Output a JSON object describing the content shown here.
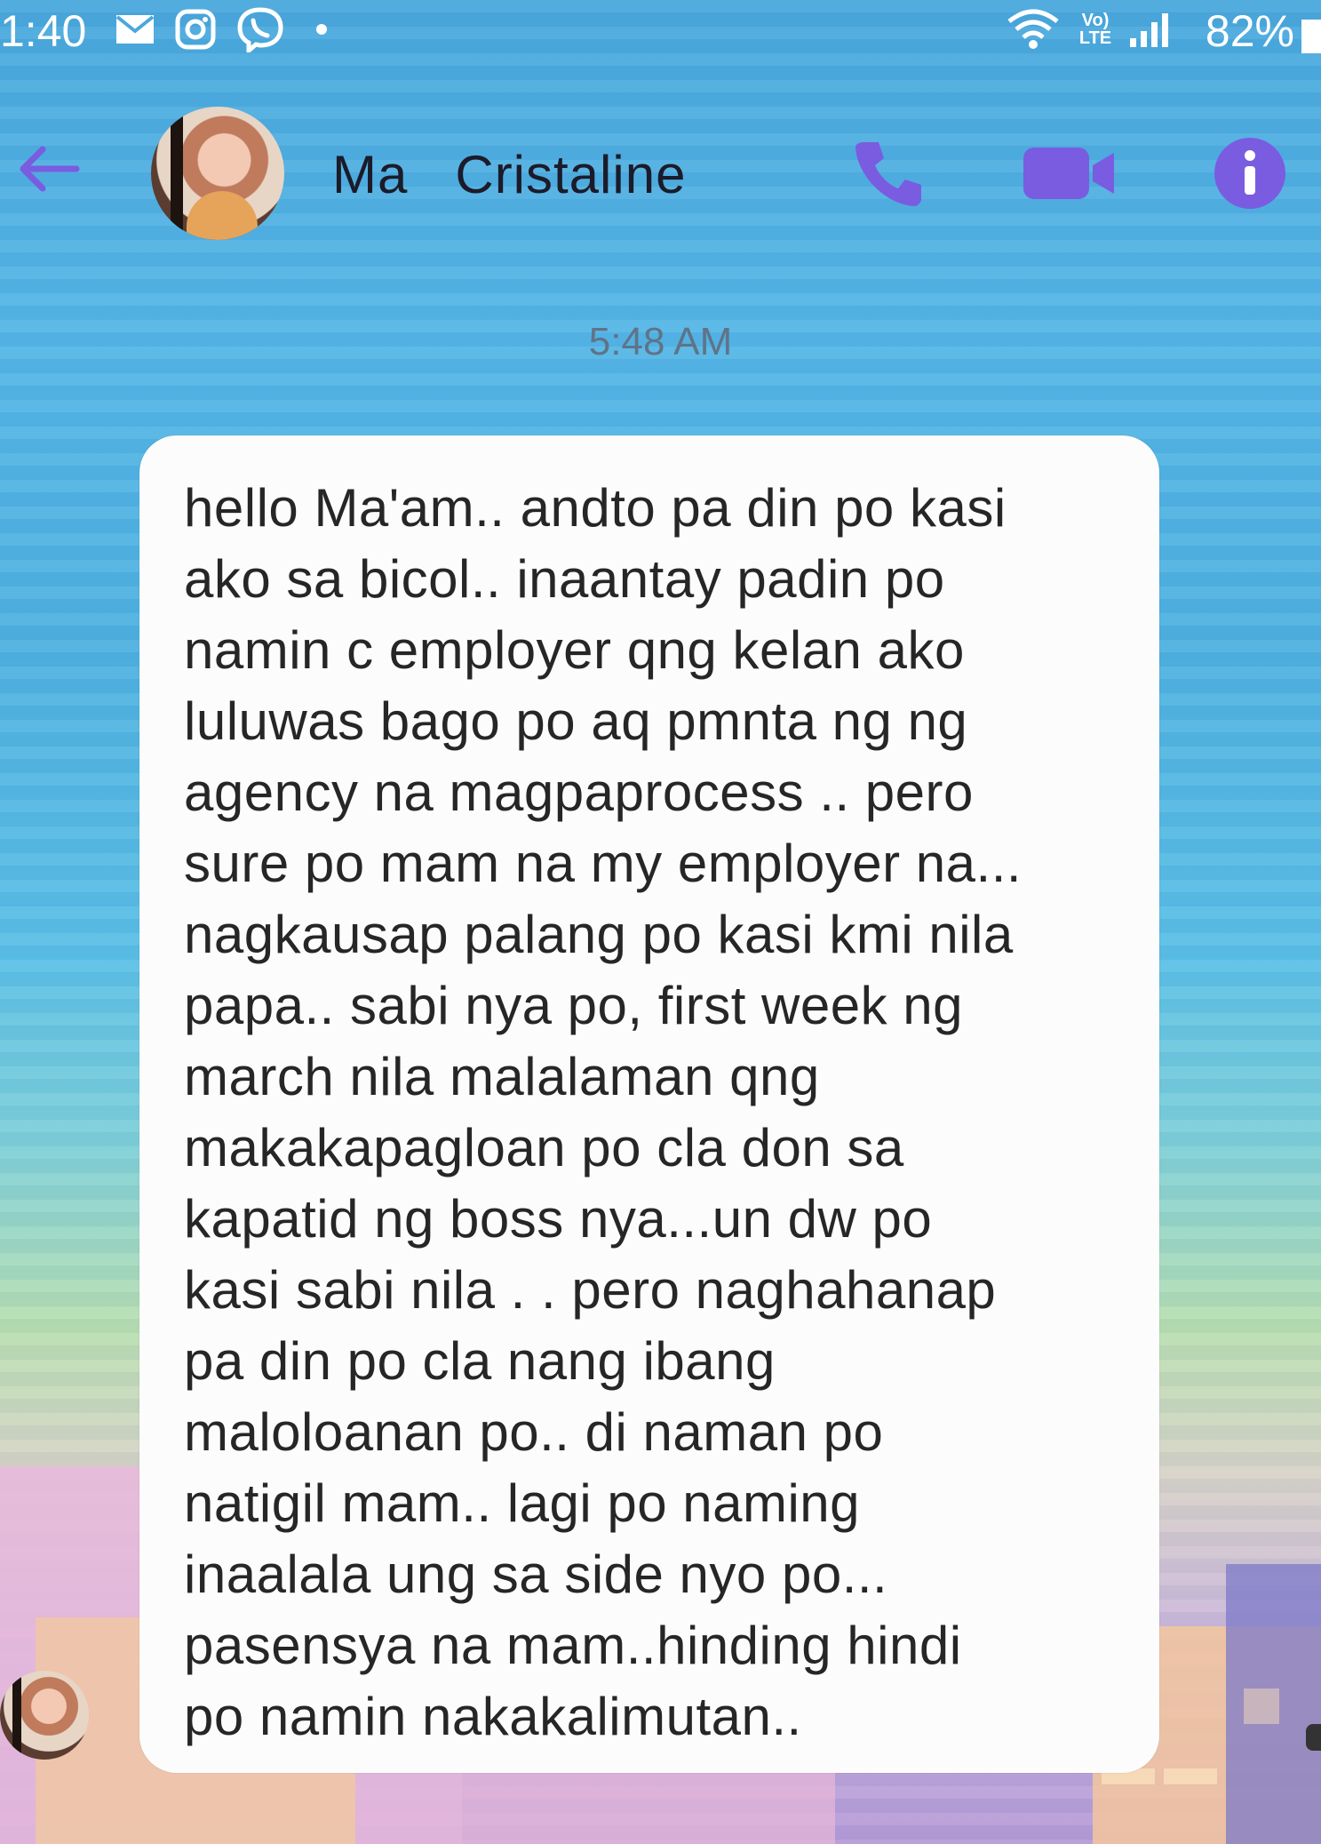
{
  "status_bar": {
    "time": "1:40",
    "battery": "82%",
    "icons": [
      "mail-icon",
      "instagram-icon",
      "viber-icon",
      "dot-icon",
      "wifi-icon",
      "volte-icon",
      "signal-icon",
      "battery-icon"
    ],
    "volte_label_top": "Vo)",
    "volte_label_bottom": "LTE"
  },
  "header": {
    "contact_name": "Ma   Cristaline",
    "icons": [
      "back-arrow-icon",
      "phone-icon",
      "video-call-icon",
      "info-icon"
    ],
    "accent_color": "#7a5ce0"
  },
  "conversation": {
    "timestamp": "5:48 AM",
    "messages": [
      {
        "text": "hello Ma'am.. andto pa din po kasi\nako sa bicol.. inaantay padin po\nnamin c employer qng kelan ako\nluluwas bago po aq pmnta ng ng\nagency na magpaprocess .. pero\nsure po mam na my employer na...\nnagkausap palang po kasi kmi nila\npapa.. sabi nya po, first week ng\nmarch nila malalaman qng\nmakakapagloan po cla don sa\nkapatid ng boss nya...un dw po\nkasi sabi nila . . pero naghahanap\npa din po cla nang ibang\nmaloloanan po..  di naman po\nnatigil mam.. lagi po naming\ninaalala ung sa side nyo po...\npasensya na mam..hinding hindi\npo namin nakakalimutan.."
      }
    ]
  }
}
